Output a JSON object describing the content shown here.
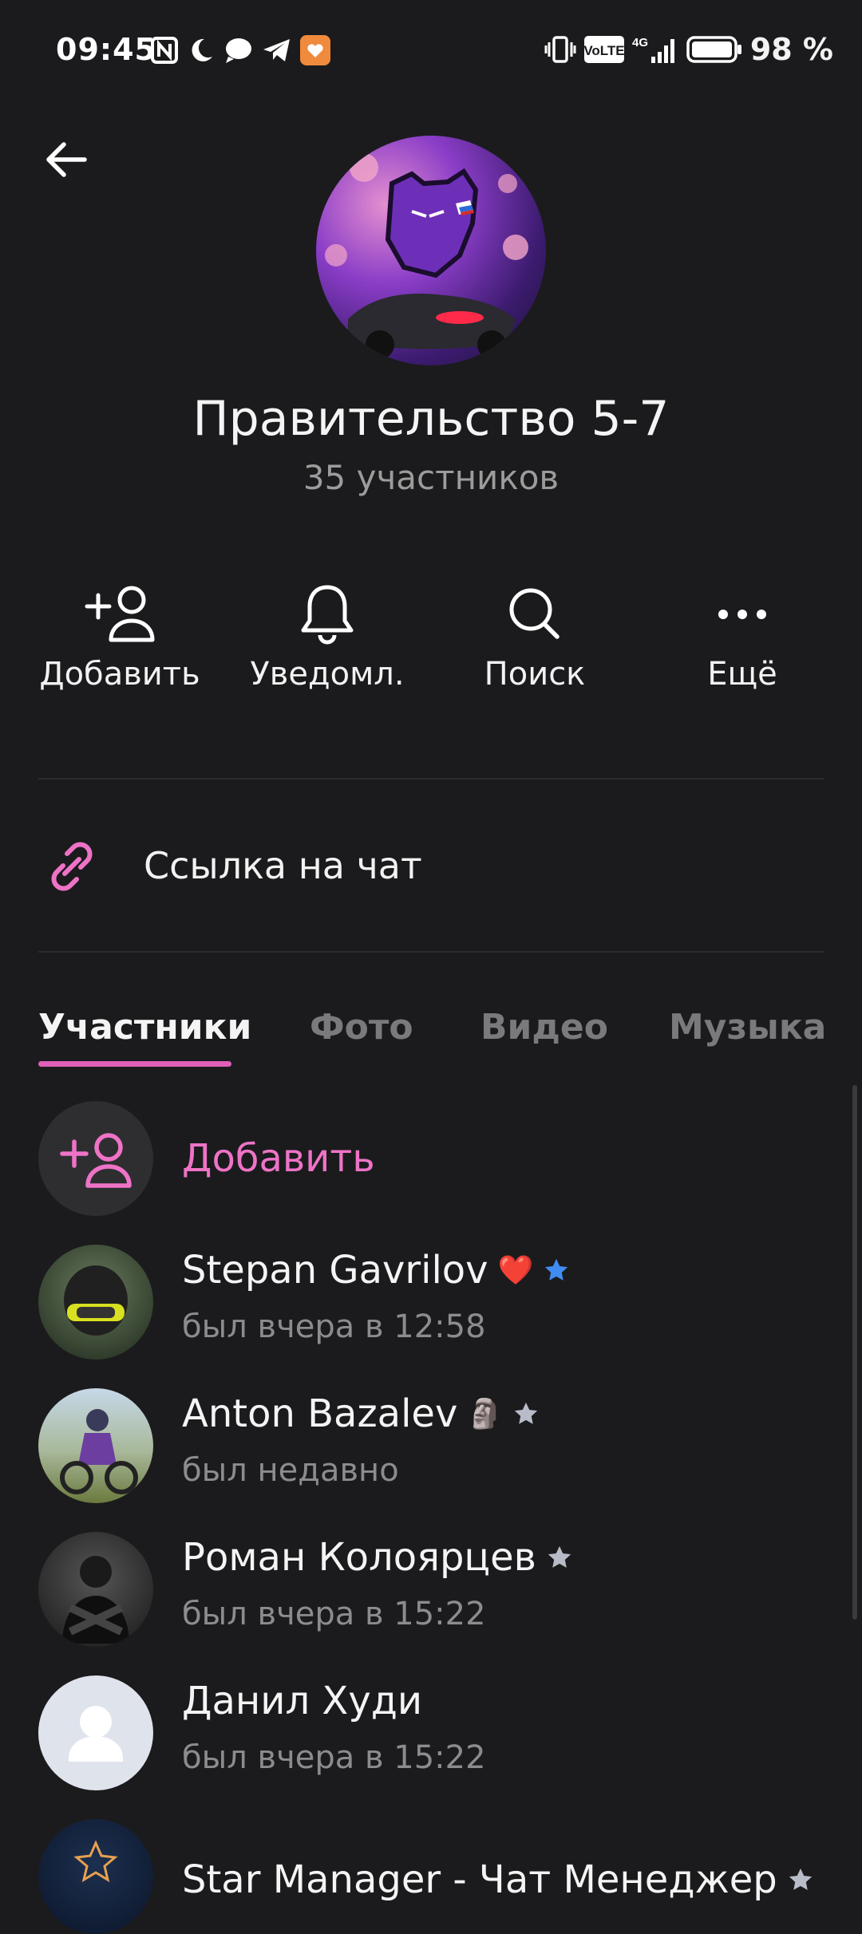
{
  "status_bar": {
    "time": "09:45",
    "battery": "98 %",
    "icons": [
      "nfc-icon",
      "moon-icon",
      "chat-bubble-icon",
      "telegram-icon",
      "app-notification-icon",
      "vibrate-icon",
      "volte-icon",
      "signal-4g-icon",
      "battery-icon"
    ]
  },
  "header": {
    "title": "Правительство 5-7",
    "subtitle": "35 участников"
  },
  "actions": [
    {
      "label": "Добавить",
      "icon": "add-user-icon"
    },
    {
      "label": "Уведомл.",
      "icon": "bell-icon"
    },
    {
      "label": "Поиск",
      "icon": "search-icon"
    },
    {
      "label": "Ещё",
      "icon": "more-icon"
    }
  ],
  "chat_link": {
    "label": "Ссылка на чат",
    "icon": "link-icon"
  },
  "tabs": [
    {
      "label": "Участники",
      "active": true
    },
    {
      "label": "Фото",
      "active": false
    },
    {
      "label": "Видео",
      "active": false
    },
    {
      "label": "Музыка",
      "active": false
    }
  ],
  "add_member": {
    "label": "Добавить"
  },
  "members": [
    {
      "name": "Stepan Gavrilov",
      "status": "был вчера в 12:58",
      "badge": "❤️",
      "star_color": "#3f8df2"
    },
    {
      "name": "Anton Bazalev",
      "status": "был недавно",
      "badge": "🗿",
      "star_color": "#b8bcc8"
    },
    {
      "name": "Роман Колоярцев",
      "status": "был вчера в 15:22",
      "badge": "",
      "star_color": "#b8bcc8"
    },
    {
      "name": "Данил Худи",
      "status": "был вчера в 15:22",
      "badge": "",
      "star_color": ""
    },
    {
      "name": "Star Manager - Чат Менеджер",
      "status": "",
      "badge": "",
      "star_color": "#b8bcc8"
    }
  ],
  "colors": {
    "accent": "#ee73c6",
    "background": "#1b1b1d",
    "muted": "#8c8c8e"
  }
}
